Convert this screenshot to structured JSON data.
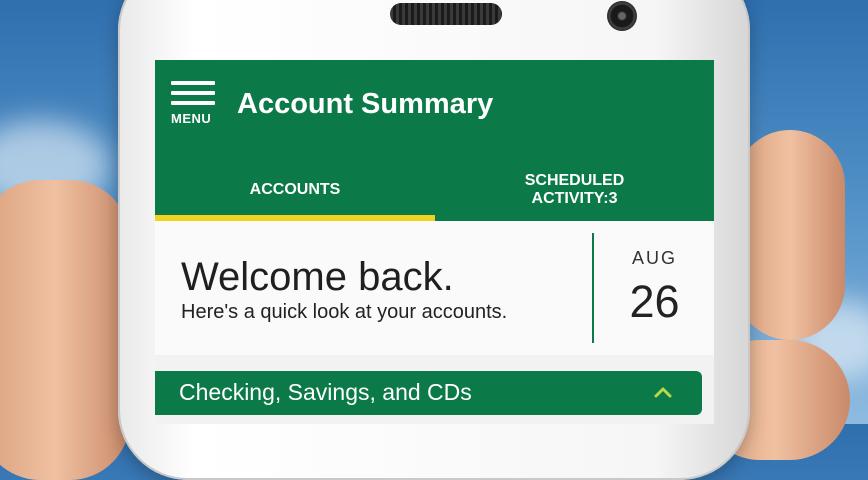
{
  "app": {
    "title": "Account Summary",
    "menu_label": "MENU"
  },
  "tabs": [
    {
      "label": "ACCOUNTS",
      "active": true
    },
    {
      "label": "SCHEDULED ACTIVITY:3",
      "active": false
    }
  ],
  "welcome": {
    "heading": "Welcome back.",
    "subtext": "Here's a quick look at your accounts."
  },
  "date": {
    "month": "AUG",
    "day": "26"
  },
  "sections": [
    {
      "label": "Checking, Savings, and CDs",
      "icon": "chevron-up-icon",
      "expanded": true
    }
  ],
  "colors": {
    "brand_green": "#0b7a48",
    "tab_indicator": "#f0d21f",
    "chevron": "#b8d94a"
  }
}
